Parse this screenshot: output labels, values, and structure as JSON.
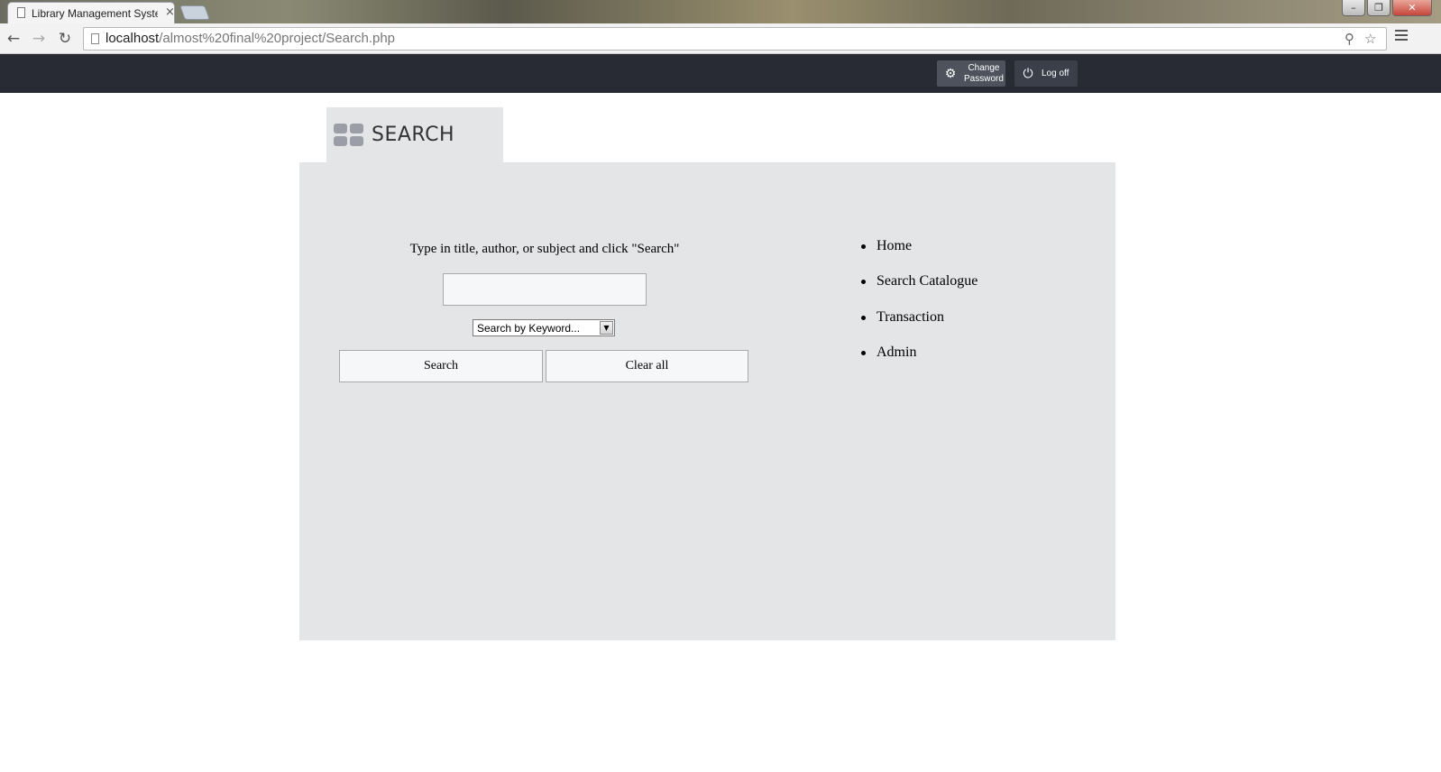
{
  "browser": {
    "tab_title": "Library Management System",
    "tab_close": "×",
    "url_host": "localhost",
    "url_path": "/almost%20final%20project/Search.php",
    "window_buttons": [
      "–",
      "❐",
      "✕"
    ]
  },
  "header": {
    "change_password_line1": "Change",
    "change_password_line2": "Password",
    "logoff_label": "Log off",
    "icons": {
      "change_password": "gear-icon",
      "logoff": "power-icon"
    }
  },
  "section": {
    "title": "SEARCH",
    "icon": "grid-icon"
  },
  "search": {
    "instruction": "Type in title, author, or subject and click \"Search\"",
    "input_value": "",
    "select_value": "Search by Keyword...",
    "search_button": "Search",
    "clear_button": "Clear all"
  },
  "nav": {
    "items": [
      {
        "label": "Home"
      },
      {
        "label": "Search Catalogue"
      },
      {
        "label": "Transaction"
      },
      {
        "label": "Admin"
      }
    ]
  },
  "colors": {
    "header_bg": "#282b33",
    "panel_bg": "#e4e5e7",
    "button_bg": "#f6f7f8"
  }
}
